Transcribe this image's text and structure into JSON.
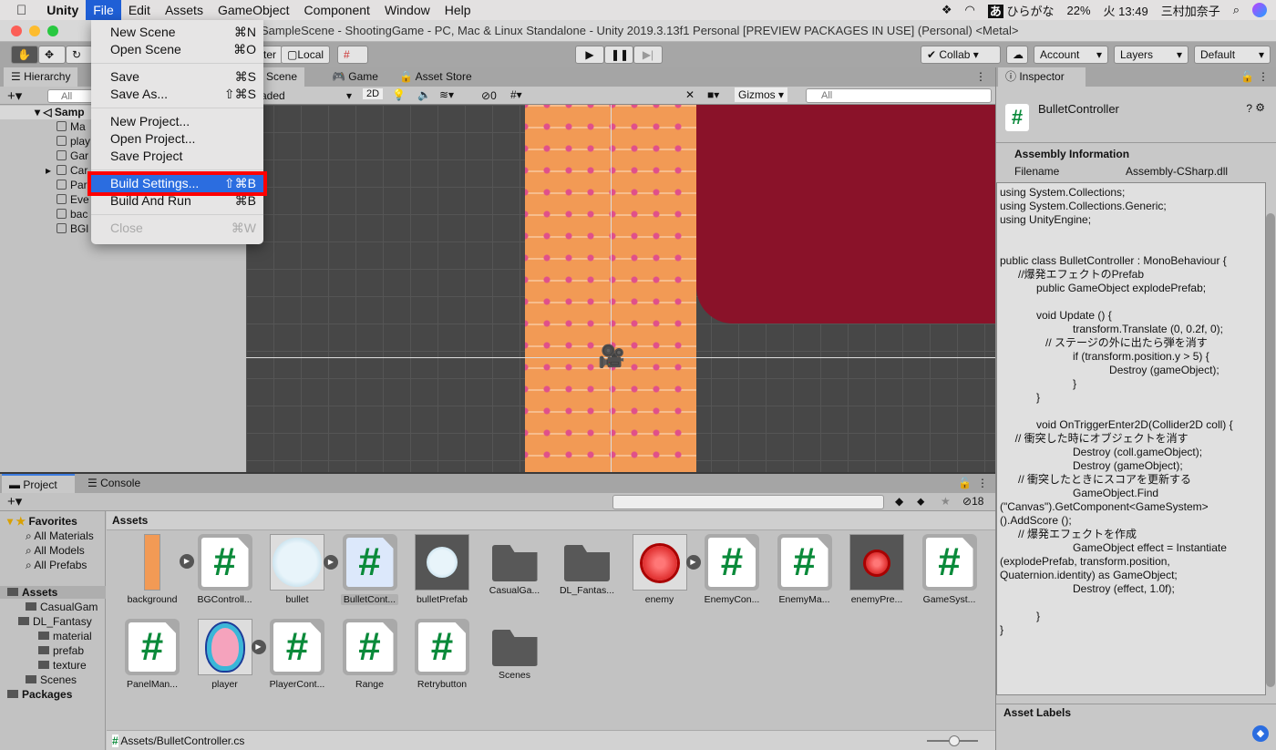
{
  "menubar": {
    "apple": "",
    "items": [
      "Unity",
      "File",
      "Edit",
      "Assets",
      "GameObject",
      "Component",
      "Window",
      "Help"
    ],
    "active": "File",
    "status": {
      "ime": "ひらがな",
      "battery": "22%",
      "clock": "火 13:49",
      "user": "三村加奈子"
    }
  },
  "window": {
    "title": "SampleScene - ShootingGame - PC, Mac & Linux Standalone - Unity 2019.3.13f1 Personal [PREVIEW PACKAGES IN USE] (Personal) <Metal>"
  },
  "toolbar": {
    "pivot_partial": "ter",
    "local": "Local",
    "collab": "Collab",
    "account": "Account",
    "layers": "Layers",
    "layout": "Default"
  },
  "file_menu": [
    {
      "label": "New Scene",
      "shortcut": "⌘N"
    },
    {
      "label": "Open Scene",
      "shortcut": "⌘O"
    },
    {
      "sep": true
    },
    {
      "label": "Save",
      "shortcut": "⌘S"
    },
    {
      "label": "Save As...",
      "shortcut": "⇧⌘S"
    },
    {
      "sep": true
    },
    {
      "label": "New Project...",
      "shortcut": ""
    },
    {
      "label": "Open Project...",
      "shortcut": ""
    },
    {
      "label": "Save Project",
      "shortcut": ""
    },
    {
      "sep": true
    },
    {
      "label": "Build Settings...",
      "shortcut": "⇧⌘B",
      "highlighted": true
    },
    {
      "label": "Build And Run",
      "shortcut": "⌘B"
    },
    {
      "sep": true
    },
    {
      "label": "Close",
      "shortcut": "⌘W",
      "disabled": true
    }
  ],
  "hierarchy": {
    "tab": "Hierarchy",
    "search_placeholder": "All",
    "scene": "Samp",
    "items": [
      "Ma",
      "play",
      "Gar",
      "Car",
      "Par",
      "Eve",
      "bac",
      "BGl"
    ]
  },
  "scene": {
    "tabs": [
      "Scene",
      "Game",
      "Asset Store"
    ],
    "draw_mode": "aded",
    "mode_2d": "2D",
    "hidden_count": "0",
    "gizmos": "Gizmos",
    "search_placeholder": "All"
  },
  "inspector": {
    "tab": "Inspector",
    "object_name": "BulletController",
    "assembly_header": "Assembly Information",
    "filename_label": "Filename",
    "filename_value": "Assembly-CSharp.dll",
    "asset_labels": "Asset Labels",
    "code": [
      "using System.Collections;",
      "using System.Collections.Generic;",
      "using UnityEngine;",
      "",
      "",
      "public class BulletController : MonoBehaviour {",
      "      //爆発エフェクトのPrefab",
      "            public GameObject explodePrefab;",
      "",
      "            void Update () {",
      "                        transform.Translate (0, 0.2f, 0);",
      "               // ステージの外に出たら弾を消す",
      "                        if (transform.position.y > 5) {",
      "                                    Destroy (gameObject);",
      "                        }",
      "            }",
      "",
      "            void OnTriggerEnter2D(Collider2D coll) {",
      "     // 衝突した時にオブジェクトを消す",
      "                        Destroy (coll.gameObject);",
      "                        Destroy (gameObject);",
      "      // 衝突したときにスコアを更新する",
      "                        GameObject.Find",
      "(\"Canvas\").GetComponent<GameSystem>",
      "().AddScore ();",
      "      // 爆発エフェクトを作成",
      "                        GameObject effect = Instantiate",
      "(explodePrefab, transform.position,",
      "Quaternion.identity) as GameObject;",
      "                        Destroy (effect, 1.0f);",
      "",
      "            }",
      "}"
    ]
  },
  "project": {
    "tabs": [
      "Project",
      "Console"
    ],
    "hidden_count": "18",
    "breadcrumb": "Assets",
    "path": "Assets/BulletController.cs",
    "tree": [
      {
        "label": "Favorites",
        "bold": true,
        "kind": "star"
      },
      {
        "label": "All Materials",
        "kind": "search"
      },
      {
        "label": "All Models",
        "kind": "search"
      },
      {
        "label": "All Prefabs",
        "kind": "search"
      },
      {
        "label": "Assets",
        "bold": true,
        "kind": "folder",
        "selected": true
      },
      {
        "label": "CasualGam",
        "kind": "folder"
      },
      {
        "label": "DL_Fantasy",
        "kind": "folder"
      },
      {
        "label": "material",
        "kind": "folder"
      },
      {
        "label": "prefab",
        "kind": "folder"
      },
      {
        "label": "texture",
        "kind": "folder"
      },
      {
        "label": "Scenes",
        "kind": "folder"
      },
      {
        "label": "Packages",
        "bold": true,
        "kind": "folder"
      }
    ],
    "assets": [
      {
        "label": "background",
        "type": "texture",
        "arrow": true
      },
      {
        "label": "BGControll...",
        "type": "script"
      },
      {
        "label": "bullet",
        "type": "bubble",
        "arrow": true
      },
      {
        "label": "BulletCont...",
        "type": "script",
        "selected": true
      },
      {
        "label": "bulletPrefab",
        "type": "bubble-prefab"
      },
      {
        "label": "CasualGa...",
        "type": "folder"
      },
      {
        "label": "DL_Fantas...",
        "type": "folder"
      },
      {
        "label": "enemy",
        "type": "virus",
        "arrow": true
      },
      {
        "label": "EnemyCon...",
        "type": "script"
      },
      {
        "label": "EnemyMa...",
        "type": "script"
      },
      {
        "label": "enemyPre...",
        "type": "virus-prefab"
      },
      {
        "label": "GameSyst...",
        "type": "script"
      },
      {
        "label": "PanelMan...",
        "type": "script"
      },
      {
        "label": "player",
        "type": "player",
        "arrow": true
      },
      {
        "label": "PlayerCont...",
        "type": "script"
      },
      {
        "label": "Range",
        "type": "script"
      },
      {
        "label": "Retrybutton",
        "type": "script"
      },
      {
        "label": "Scenes",
        "type": "folder"
      }
    ]
  },
  "colors": {
    "highlight": "#2b6de0",
    "callout": "#ff0000",
    "script_hash": "#0a8a3a",
    "scene_red": "#8a1229",
    "bg_orange": "#f29a55"
  }
}
